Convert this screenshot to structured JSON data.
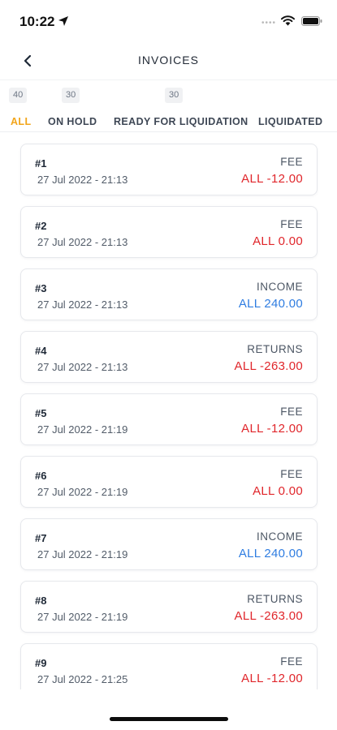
{
  "status": {
    "time": "10:22"
  },
  "nav": {
    "title": "INVOICES"
  },
  "tabs": [
    {
      "label": "ALL",
      "count": "40",
      "active": true
    },
    {
      "label": "ON HOLD",
      "count": "30",
      "active": false
    },
    {
      "label": "READY FOR LIQUIDATION",
      "count": "30",
      "active": false
    },
    {
      "label": "LIQUIDATED",
      "count": "",
      "active": false
    }
  ],
  "invoices": [
    {
      "number": "#1",
      "date": "27 Jul 2022 - 21:13",
      "type": "FEE",
      "amount": "ALL -12.00",
      "sign": "neg"
    },
    {
      "number": "#2",
      "date": "27 Jul 2022 - 21:13",
      "type": "FEE",
      "amount": "ALL 0.00",
      "sign": "neg"
    },
    {
      "number": "#3",
      "date": "27 Jul 2022 - 21:13",
      "type": "INCOME",
      "amount": "ALL 240.00",
      "sign": "pos"
    },
    {
      "number": "#4",
      "date": "27 Jul 2022 - 21:13",
      "type": "RETURNS",
      "amount": "ALL -263.00",
      "sign": "neg"
    },
    {
      "number": "#5",
      "date": "27 Jul 2022 - 21:19",
      "type": "FEE",
      "amount": "ALL -12.00",
      "sign": "neg"
    },
    {
      "number": "#6",
      "date": "27 Jul 2022 - 21:19",
      "type": "FEE",
      "amount": "ALL 0.00",
      "sign": "neg"
    },
    {
      "number": "#7",
      "date": "27 Jul 2022 - 21:19",
      "type": "INCOME",
      "amount": "ALL 240.00",
      "sign": "pos"
    },
    {
      "number": "#8",
      "date": "27 Jul 2022 - 21:19",
      "type": "RETURNS",
      "amount": "ALL -263.00",
      "sign": "neg"
    },
    {
      "number": "#9",
      "date": "27 Jul 2022 - 21:25",
      "type": "FEE",
      "amount": "ALL -12.00",
      "sign": "neg"
    }
  ],
  "colors": {
    "active_tab": "#f2a51a",
    "negative": "#e0262b",
    "positive": "#2f7de1"
  }
}
